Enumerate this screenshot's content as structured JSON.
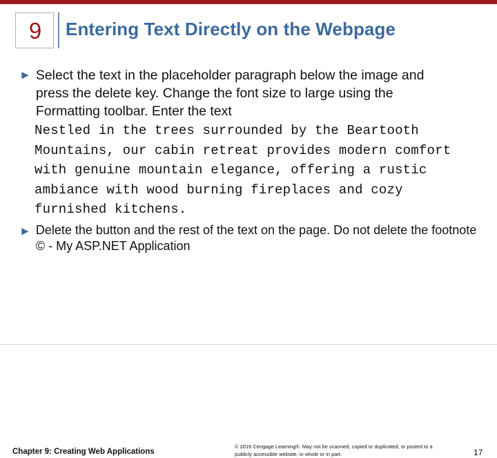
{
  "slide": {
    "accent_color": "#9a1a1a",
    "title_color": "#3b6a9c",
    "chapter_number": "9",
    "title": "Entering Text Directly on the Webpage",
    "bullets": [
      {
        "marker": "►",
        "text": "Select the text in the placeholder paragraph below the image and press the delete key. Change the font size to large using the Formatting toolbar. Enter the text"
      },
      {
        "marker": "►",
        "text": "Delete the button and the rest of the text on the page. Do not delete the footnote © - My ASP.NET Application"
      }
    ],
    "monospace_text": "Nestled in the trees surrounded by the Beartooth Mountains, our cabin retreat provides modern comfort with genuine mountain elegance, offering a rustic ambiance with wood burning fireplaces and cozy furnished kitchens."
  },
  "footer": {
    "left": "Chapter 9: Creating Web Applications",
    "copyright": "© 2016 Cengage Learning®. May not be scanned, copied or duplicated, or posted to a publicly accessible website, in whole or in part.",
    "page_number": "17"
  }
}
